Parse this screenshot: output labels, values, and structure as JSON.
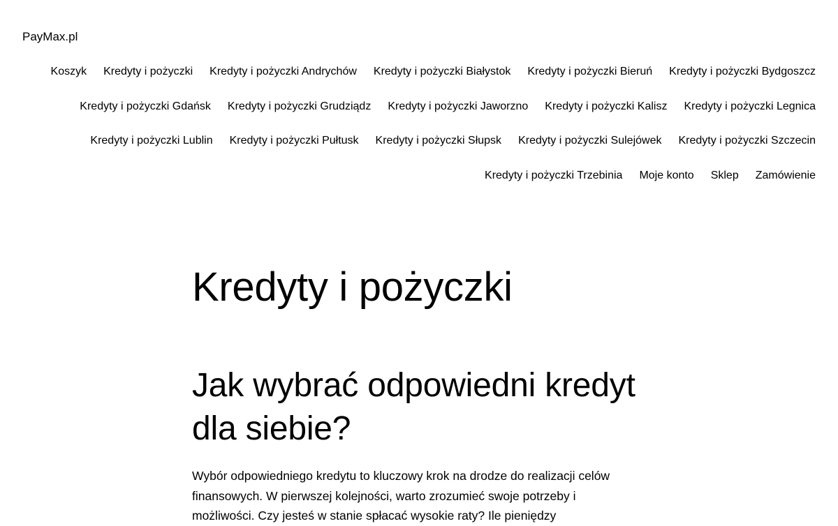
{
  "site": {
    "title": "PayMax.pl"
  },
  "nav": {
    "rows": [
      [
        "Koszyk",
        "Kredyty i pożyczki",
        "Kredyty i pożyczki Andrychów",
        "Kredyty i pożyczki Białystok",
        "Kredyty i pożyczki Bieruń",
        "Kredyty i pożyczki Bydgoszcz"
      ],
      [
        "Kredyty i pożyczki Gdańsk",
        "Kredyty i pożyczki Grudziądz",
        "Kredyty i pożyczki Jaworzno",
        "Kredyty i pożyczki Kalisz",
        "Kredyty i pożyczki Legnica"
      ],
      [
        "Kredyty i pożyczki Lublin",
        "Kredyty i pożyczki Pułtusk",
        "Kredyty i pożyczki Słupsk",
        "Kredyty i pożyczki Sulejówek",
        "Kredyty i pożyczki Szczecin"
      ],
      [
        "Kredyty i pożyczki Trzebinia",
        "Moje konto",
        "Sklep",
        "Zamówienie"
      ]
    ]
  },
  "main": {
    "page_title": "Kredyty i pożyczki",
    "section_heading": "Jak wybrać odpowiedni kredyt dla siebie?",
    "paragraph": "Wybór odpowiedniego kredytu to kluczowy krok na drodze do realizacji celów finansowych. W pierwszej kolejności, warto zrozumieć swoje potrzeby i możliwości. Czy jesteś w stanie spłacać wysokie raty? Ile pieniędzy"
  }
}
